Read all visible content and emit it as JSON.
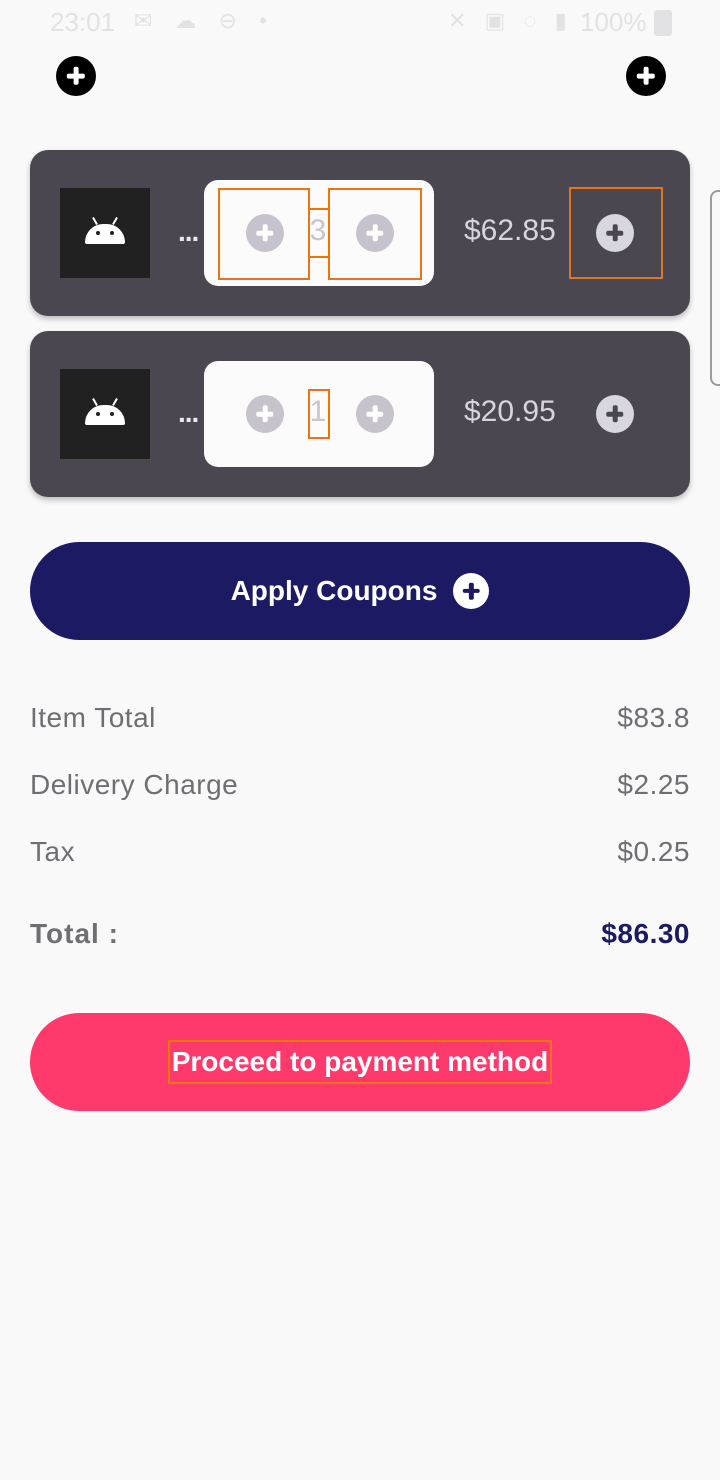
{
  "status_bar": {
    "time": "23:01",
    "left_icons": "✉ ☁ ⊖ •",
    "right_icons": "✕ ▣ ◌ ▮",
    "battery": "100%"
  },
  "header": {
    "left_icon": "add-circle-icon",
    "right_icon": "add-circle-icon"
  },
  "cart": {
    "items": [
      {
        "name": "...",
        "quantity": "3",
        "price": "$62.85"
      },
      {
        "name": "...",
        "quantity": "1",
        "price": "$20.95"
      }
    ]
  },
  "coupon": {
    "label": "Apply Coupons",
    "icon": "add-circle-icon"
  },
  "summary": {
    "rows": [
      {
        "label": "Item Total",
        "value": "$83.8"
      },
      {
        "label": "Delivery Charge",
        "value": "$2.25"
      },
      {
        "label": "Tax",
        "value": "$0.25"
      }
    ],
    "total_label": "Total :",
    "total_value": "$86.30"
  },
  "proceed": {
    "label": "Proceed to payment method"
  },
  "colors": {
    "card_bg": "#4a4750",
    "coupon_bg": "#1b1a62",
    "proceed_bg": "#fe3a6c",
    "highlight": "#ea7414",
    "page_bg": "#f9f9fa"
  }
}
